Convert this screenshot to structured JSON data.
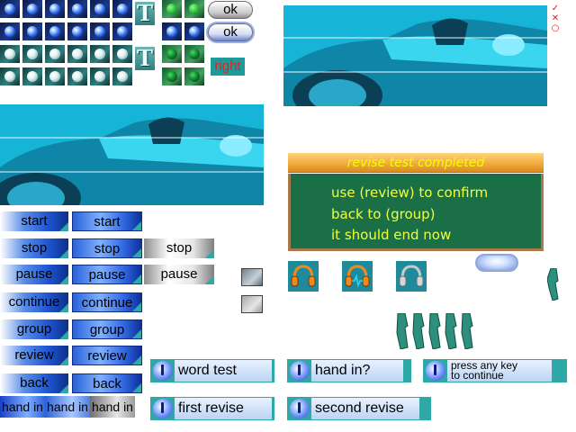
{
  "ok_buttons": {
    "ok_1": "ok",
    "ok_2": "ok"
  },
  "right_label": "right",
  "t_glyph": "T",
  "corner_icons": [
    "check-icon",
    "close-icon",
    "circle-icon"
  ],
  "dialog": {
    "title": "revise test completed",
    "lines": [
      "use (review) to confirm",
      "back to (group)",
      "it should end now"
    ]
  },
  "buttons": {
    "start": "start",
    "stop": "stop",
    "pause": "pause",
    "continue": "continue",
    "group": "group",
    "review": "review",
    "back": "back",
    "hand_in": "hand in"
  },
  "bars": {
    "word_test": "word test",
    "hand_in": "hand in?",
    "press_any_key_1": "press any key",
    "press_any_key_2": "to continue",
    "first_revise": "first revise",
    "second_revise": "second revise"
  },
  "colors": {
    "teal": "#2fa8a8",
    "dialog_green": "#1a6f46",
    "dialog_text": "#f2ff3a",
    "right_text": "#e81e1e"
  },
  "icons": {
    "folder": "folder-icon",
    "headphones": "headphones-icon",
    "mic": "microphone-icon",
    "clip": "clip-icon",
    "oval": "oval-button"
  }
}
